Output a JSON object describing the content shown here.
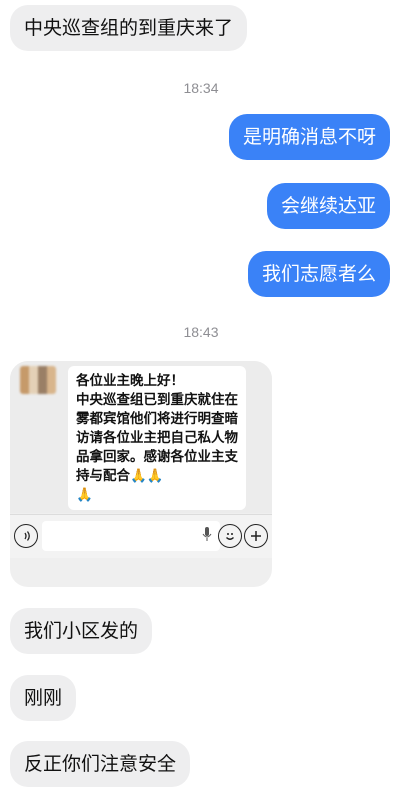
{
  "messages": {
    "m1": "中央巡查组的到重庆来了",
    "t1": "18:34",
    "s1": "是明确消息不呀",
    "s2": "会继续达亚",
    "s3": "我们志愿者么",
    "t2": "18:43",
    "card_text": "各位业主晚上好！\n中央巡查组已到重庆就住在雾都宾馆他们将进行明查暗访请各位业主把自己私人物品拿回家。感谢各位业主支持与配合🙏🙏\n🙏",
    "m2": "我们小区发的",
    "m3": "刚刚",
    "m4": "反正你们注意安全"
  },
  "icons": {
    "voice": "voice-icon",
    "mic": "mic-icon",
    "emoji": "emoji-icon",
    "plus": "plus-icon"
  },
  "colors": {
    "sent_bubble": "#3a82f7",
    "received_bubble": "#eeeeef",
    "timestamp": "#8e8e93"
  }
}
